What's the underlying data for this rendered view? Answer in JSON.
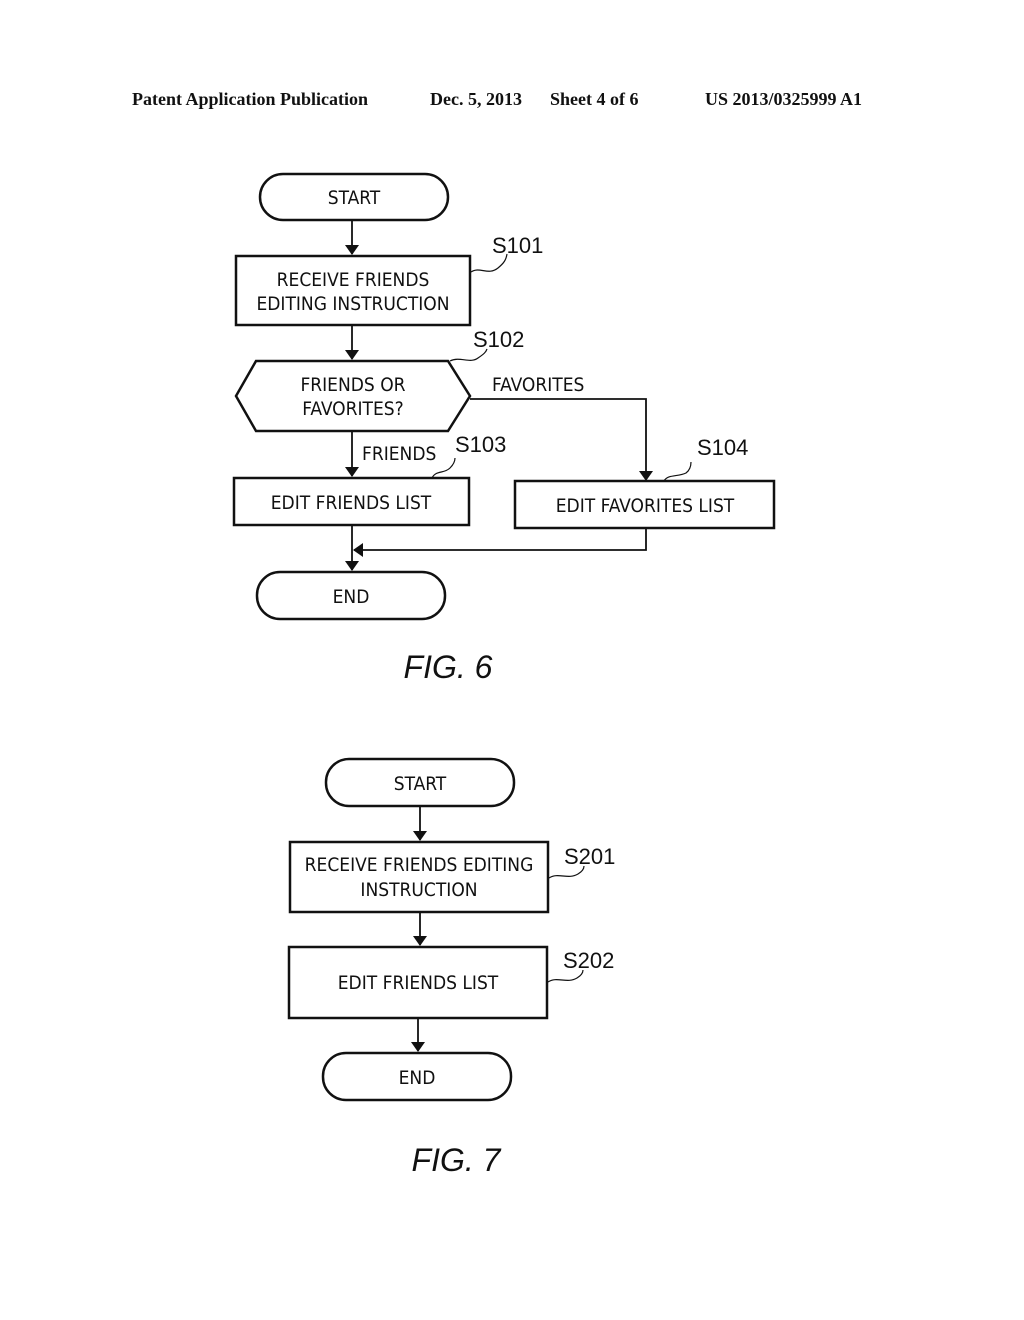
{
  "header": {
    "publication": "Patent Application Publication",
    "date": "Dec. 5, 2013",
    "sheet": "Sheet 4 of 6",
    "number": "US 2013/0325999 A1"
  },
  "fig6": {
    "caption": "FIG. 6",
    "start": "START",
    "s101": {
      "ref": "S101",
      "line1": "RECEIVE FRIENDS",
      "line2": "EDITING INSTRUCTION"
    },
    "s102": {
      "ref": "S102",
      "line1": "FRIENDS OR",
      "line2": "FAVORITES?",
      "branch_right": "FAVORITES",
      "branch_down": "FRIENDS"
    },
    "s103": {
      "ref": "S103",
      "text": "EDIT FRIENDS LIST"
    },
    "s104": {
      "ref": "S104",
      "text": "EDIT FAVORITES LIST"
    },
    "end": "END"
  },
  "fig7": {
    "caption": "FIG. 7",
    "start": "START",
    "s201": {
      "ref": "S201",
      "line1": "RECEIVE FRIENDS EDITING",
      "line2": "INSTRUCTION"
    },
    "s202": {
      "ref": "S202",
      "text": "EDIT FRIENDS LIST"
    },
    "end": "END"
  }
}
